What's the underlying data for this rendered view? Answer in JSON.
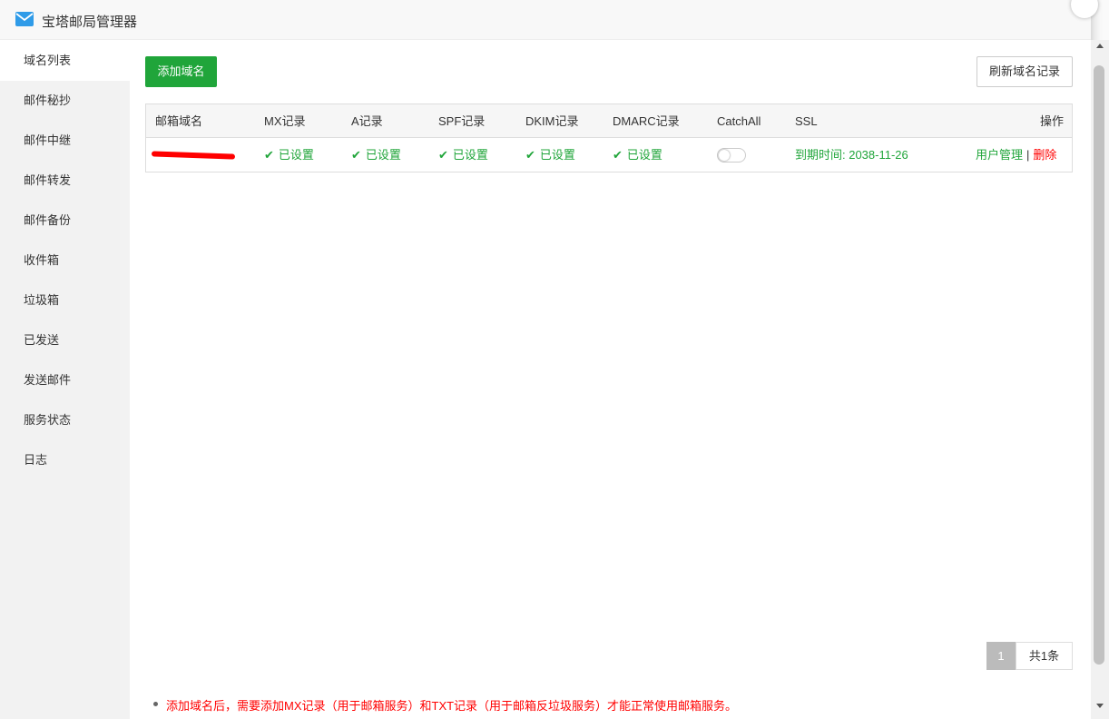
{
  "window": {
    "title": "宝塔邮局管理器"
  },
  "sidebar": {
    "items": [
      {
        "label": "域名列表",
        "active": true
      },
      {
        "label": "邮件秘抄",
        "active": false
      },
      {
        "label": "邮件中继",
        "active": false
      },
      {
        "label": "邮件转发",
        "active": false
      },
      {
        "label": "邮件备份",
        "active": false
      },
      {
        "label": "收件箱",
        "active": false
      },
      {
        "label": "垃圾箱",
        "active": false
      },
      {
        "label": "已发送",
        "active": false
      },
      {
        "label": "发送邮件",
        "active": false
      },
      {
        "label": "服务状态",
        "active": false
      },
      {
        "label": "日志",
        "active": false
      }
    ]
  },
  "toolbar": {
    "add_label": "添加域名",
    "refresh_label": "刷新域名记录"
  },
  "table": {
    "headers": {
      "domain": "邮箱域名",
      "mx": "MX记录",
      "a": "A记录",
      "spf": "SPF记录",
      "dkim": "DKIM记录",
      "dmarc": "DMARC记录",
      "catchall": "CatchAll",
      "ssl": "SSL",
      "ops": "操作"
    },
    "rows": [
      {
        "domain": "",
        "mx": "已设置",
        "a": "已设置",
        "spf": "已设置",
        "dkim": "已设置",
        "dmarc": "已设置",
        "catchall_enabled": false,
        "ssl": "到期时间: 2038-11-26",
        "user_manage": "用户管理",
        "separator": "|",
        "delete": "删除"
      }
    ]
  },
  "pagination": {
    "current": "1",
    "total": "共1条"
  },
  "notes": [
    "添加域名后，需要添加MX记录（用于邮箱服务）和TXT记录（用于邮箱反垃圾服务）才能正常使用邮箱服务。"
  ],
  "colors": {
    "accent": "#20a53a",
    "danger": "#ff0000",
    "sidebar_bg": "#f2f2f2"
  }
}
